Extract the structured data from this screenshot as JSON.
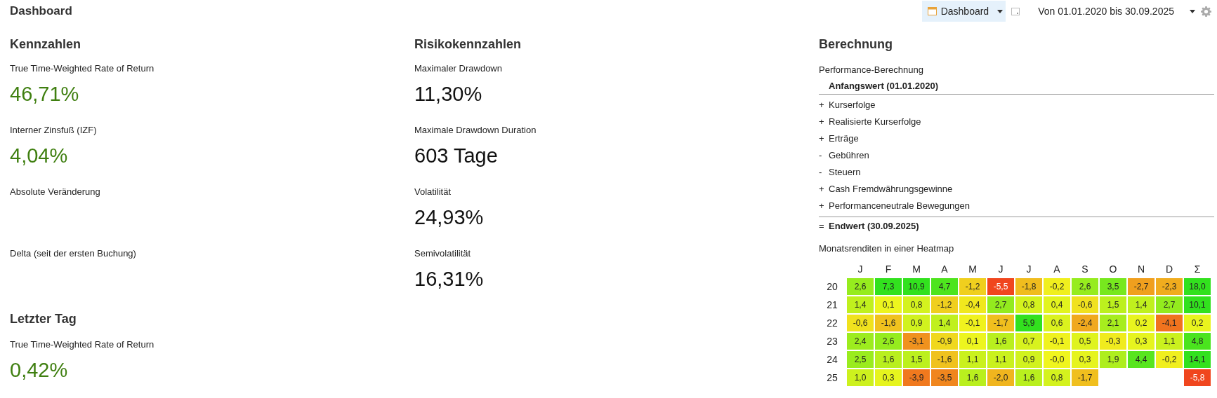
{
  "window": {
    "title": "Dashboard"
  },
  "toolbar": {
    "view_button": "Dashboard",
    "period": "Von 01.01.2020 bis 30.09.2025"
  },
  "columns": [
    {
      "title": "Kennzahlen",
      "sections": [
        {
          "metrics": [
            {
              "label": "True Time-Weighted Rate of Return",
              "value": "46,71%",
              "kind": "gain"
            },
            {
              "label": "Interner Zinsfuß (IZF)",
              "value": "4,04%",
              "kind": "gain"
            },
            {
              "label": "Absolute Veränderung"
            },
            {
              "label": "Delta (seit der ersten Buchung)"
            }
          ]
        },
        {
          "title": "Letzter Tag",
          "metrics": [
            {
              "label": "True Time-Weighted Rate of Return",
              "value": "0,42%",
              "kind": "gain"
            }
          ]
        }
      ]
    },
    {
      "title": "Risikokennzahlen",
      "sections": [
        {
          "metrics": [
            {
              "label": "Maximaler Drawdown",
              "value": "11,30%",
              "kind": "plain"
            },
            {
              "label": "Maximale Drawdown Duration",
              "value": "603 Tage",
              "kind": "plain"
            },
            {
              "label": "Volatilität",
              "value": "24,93%",
              "kind": "plain"
            },
            {
              "label": "Semivolatilität",
              "value": "16,31%",
              "kind": "plain"
            }
          ]
        }
      ]
    }
  ],
  "calculation": {
    "title": "Berechnung",
    "subtitle": "Performance-Berechnung",
    "lines": [
      {
        "label": "Anfangswert (01.01.2020)",
        "kind": "total"
      },
      {
        "sign": "+",
        "label": "Kurserfolge",
        "kind": "item"
      },
      {
        "sign": "+",
        "label": "Realisierte Kurserfolge",
        "kind": "item"
      },
      {
        "sign": "+",
        "label": "Erträge",
        "kind": "item"
      },
      {
        "sign": "-",
        "label": "Gebühren",
        "kind": "item"
      },
      {
        "sign": "-",
        "label": "Steuern",
        "kind": "item"
      },
      {
        "sign": "+",
        "label": "Cash Fremdwährungsgewinne",
        "kind": "item"
      },
      {
        "sign": "+",
        "label": "Performanceneutrale Bewegungen",
        "kind": "item"
      },
      {
        "sign": "=",
        "label": "Endwert (30.09.2025)",
        "kind": "total"
      }
    ],
    "heatmap_title": "Monatsrenditen in einer Heatmap",
    "heatmap": {
      "columns": [
        "J",
        "F",
        "M",
        "A",
        "M",
        "J",
        "J",
        "A",
        "S",
        "O",
        "N",
        "D",
        "Σ"
      ],
      "rows": [
        {
          "year": "20",
          "cells": [
            "2,6",
            "7,3",
            "10,9",
            "4,7",
            "-1,2",
            "-5,5",
            "-1,8",
            "-0,2",
            "2,6",
            "3,5",
            "-2,7",
            "-2,3",
            "18,0"
          ]
        },
        {
          "year": "21",
          "cells": [
            "1,4",
            "0,1",
            "0,8",
            "-1,2",
            "-0,4",
            "2,7",
            "0,8",
            "0,4",
            "-0,6",
            "1,5",
            "1,4",
            "2,7",
            "10,1"
          ]
        },
        {
          "year": "22",
          "cells": [
            "-0,6",
            "-1,6",
            "0,9",
            "1,4",
            "-0,1",
            "-1,7",
            "5,9",
            "0,6",
            "-2,4",
            "2,1",
            "0,2",
            "-4,1",
            "0,2"
          ]
        },
        {
          "year": "23",
          "cells": [
            "2,4",
            "2,6",
            "-3,1",
            "-0,9",
            "0,1",
            "1,6",
            "0,7",
            "-0,1",
            "0,5",
            "-0,3",
            "0,3",
            "1,1",
            "4,8"
          ]
        },
        {
          "year": "24",
          "cells": [
            "2,5",
            "1,6",
            "1,5",
            "-1,6",
            "1,1",
            "1,1",
            "0,9",
            "-0,0",
            "0,3",
            "1,9",
            "4,4",
            "-0,2",
            "14,1"
          ]
        },
        {
          "year": "25",
          "cells": [
            "1,0",
            "0,3",
            "-3,9",
            "-3,5",
            "1,6",
            "-2,0",
            "1,6",
            "0,8",
            "-1,7",
            null,
            null,
            null,
            "-5,8"
          ]
        }
      ]
    }
  }
}
